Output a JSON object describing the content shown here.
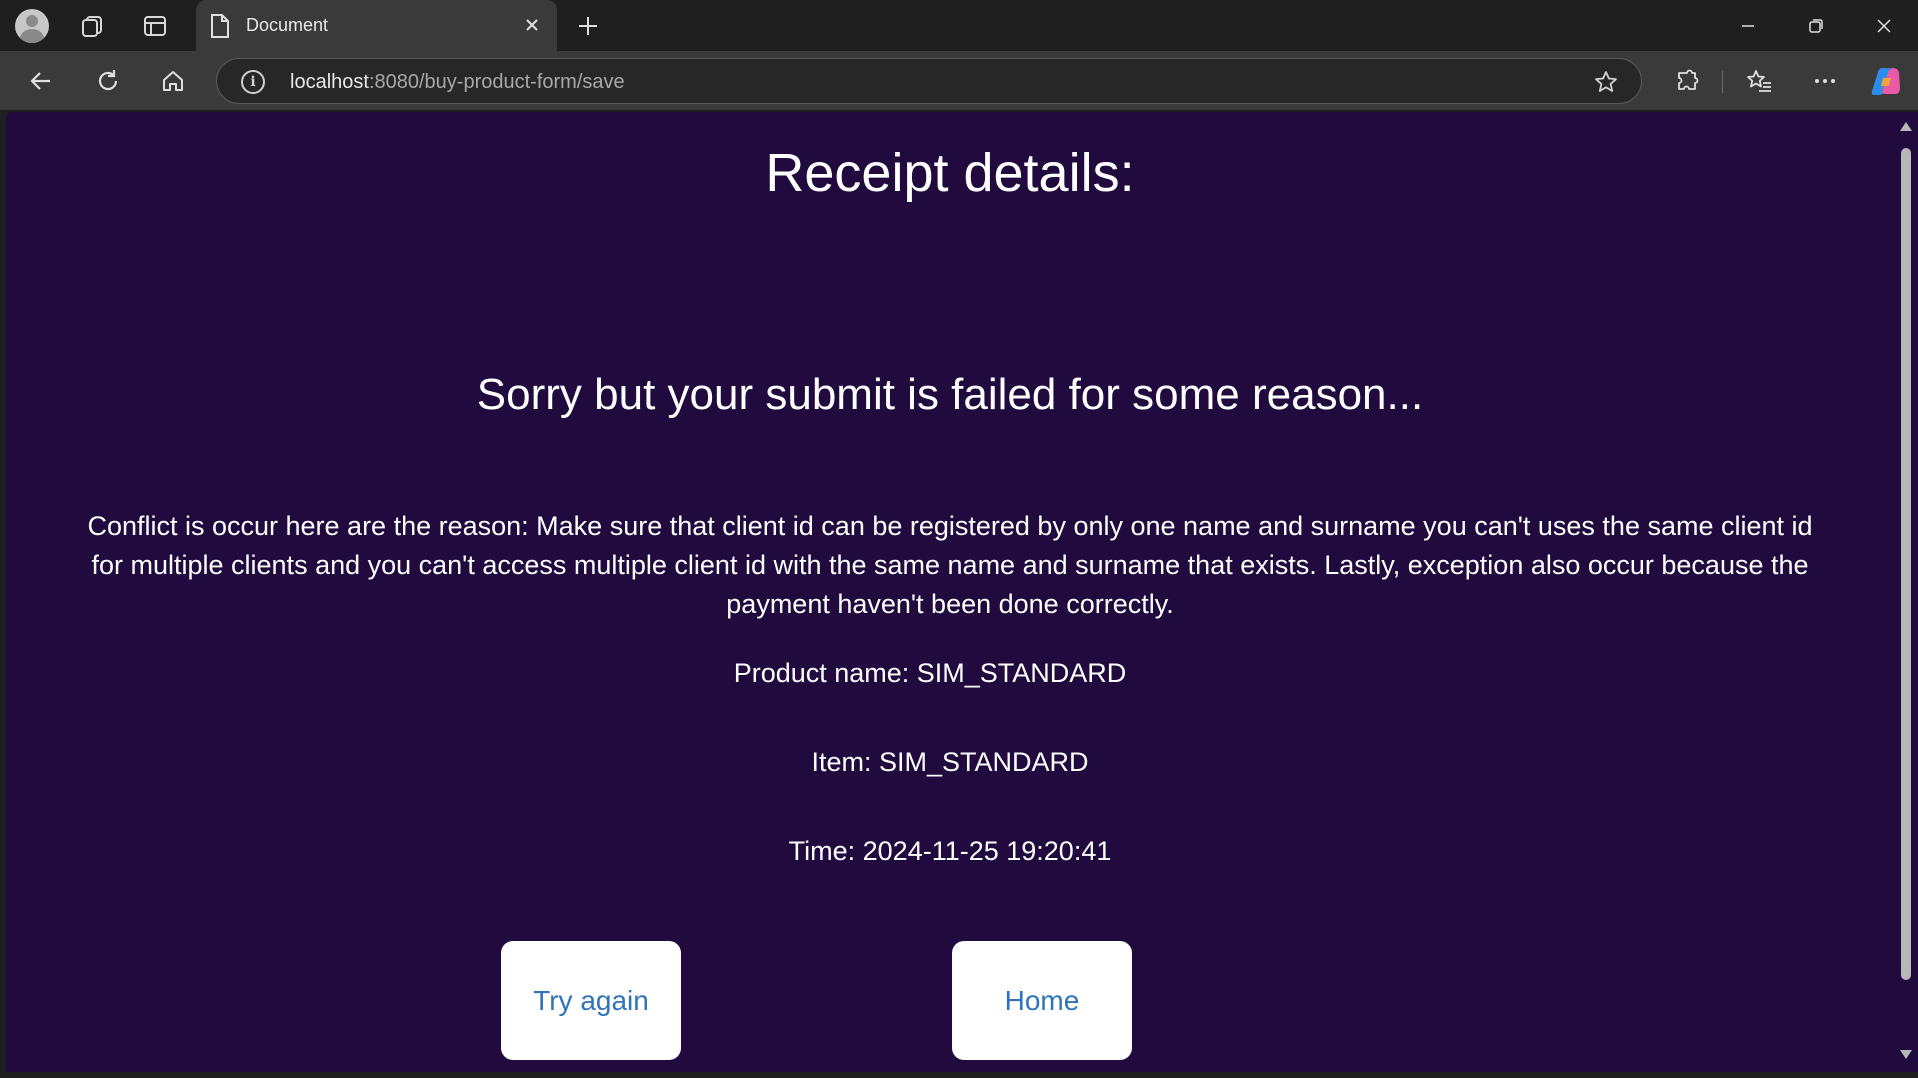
{
  "browser": {
    "tab_title": "Document",
    "url_host": "localhost",
    "url_rest": ":8080/buy-product-form/save"
  },
  "page": {
    "title": "Receipt details:",
    "failure_message": "Sorry but your submit is failed for some reason...",
    "reason_text": "Conflict is occur here are the reason: Make sure that client id can be registered by only one name and surname you can't uses the same client id for multiple clients and you can't access multiple client id with the same name and surname that exists. Lastly, exception also occur because the payment haven't been done correctly.",
    "product_name": "Product name: SIM_STANDARD",
    "item": "Item: SIM_STANDARD",
    "time": "Time: 2024-11-25 19:20:41",
    "try_again_label": "Try again",
    "home_label": "Home"
  },
  "colors": {
    "page_background": "#200a3e",
    "button_text": "#2f73b8"
  }
}
